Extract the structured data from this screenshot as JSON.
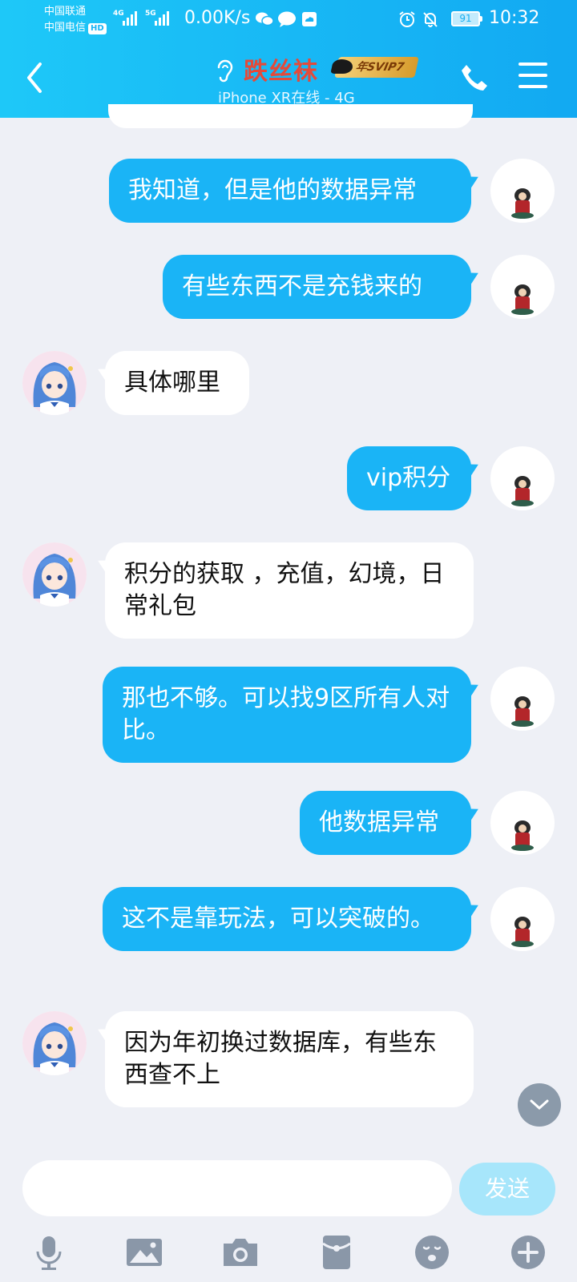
{
  "status_bar": {
    "carrier1": "中国联通",
    "carrier2": "中国电信",
    "hd": "HD",
    "net1": "4G",
    "net2": "5G",
    "speed": "0.00K/s",
    "battery": "91",
    "time": "10:32",
    "icons": [
      "wechat-icon",
      "chat-bubble-icon",
      "cloud-icon",
      "alarm-icon",
      "mute-icon"
    ]
  },
  "header": {
    "nickname": "跌丝袜",
    "badge": "年SVIP7",
    "online_status": "iPhone XR在线 - 4G",
    "icons": [
      "back-arrow-icon",
      "ear-icon",
      "phone-icon",
      "menu-icon"
    ],
    "gradient": [
      "#1ec8f8",
      "#12a9f2"
    ]
  },
  "messages": [
    {
      "sender": "me",
      "text": "我知道，但是他的数据异常"
    },
    {
      "sender": "me",
      "text": "有些东西不是充钱来的"
    },
    {
      "sender": "them",
      "text": "具体哪里"
    },
    {
      "sender": "me",
      "text": "vip积分"
    },
    {
      "sender": "them",
      "text": "积分的获取 ，充值，幻境，日常礼包"
    },
    {
      "sender": "me",
      "text": "那也不够。可以找9区所有人对比。"
    },
    {
      "sender": "me",
      "text": "他数据异常"
    },
    {
      "sender": "me",
      "text": "这不是靠玩法，可以突破的。"
    },
    {
      "sender": "them",
      "text": "因为年初换过数据库，有些东西查不上"
    }
  ],
  "input": {
    "value": "",
    "placeholder": "",
    "send_label": "发送"
  },
  "toolbar": [
    "microphone-icon",
    "image-icon",
    "camera-icon",
    "red-packet-icon",
    "emoji-icon",
    "plus-icon"
  ],
  "colors": {
    "my_bubble": "#1ab4f6",
    "their_bubble": "#ffffff",
    "background": "#eef0f6",
    "send_disabled": "#a7e6fb",
    "nickname": "#e44a3a"
  }
}
